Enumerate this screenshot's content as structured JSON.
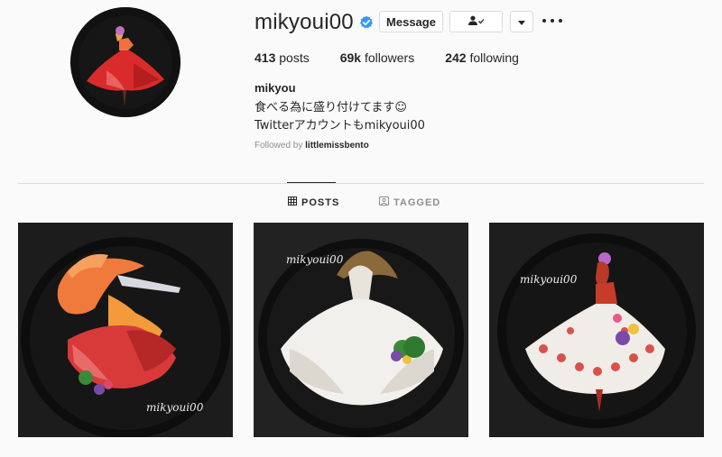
{
  "profile": {
    "username": "mikyoui00",
    "verified_icon": "verified-badge-icon",
    "message_label": "Message",
    "follow_icon": "person-check-icon",
    "dropdown_icon": "caret-down-icon",
    "more_icon": "ellipsis-icon",
    "stats": {
      "posts_count": "413",
      "posts_label": "posts",
      "followers_count": "69k",
      "followers_label": "followers",
      "following_count": "242",
      "following_label": "following"
    },
    "name": "mikyou",
    "bio_line1": "食べる為に盛り付けてます☺",
    "bio_line2": "Twitterアカウントもmikyoui00",
    "followed_by_label": "Followed by",
    "followed_by_user": "littlemissbento"
  },
  "tabs": [
    {
      "label": "POSTS",
      "icon": "grid-icon",
      "active": true
    },
    {
      "label": "TAGGED",
      "icon": "tag-icon",
      "active": false
    }
  ],
  "posts": [
    {
      "watermark": "mikyoui00"
    },
    {
      "watermark": "mikyoui00"
    },
    {
      "watermark": "mikyoui00"
    }
  ],
  "colors": {
    "verified": "#3897f0",
    "text": "#262626",
    "muted": "#8e8e8e",
    "border": "#dbdbdb"
  }
}
